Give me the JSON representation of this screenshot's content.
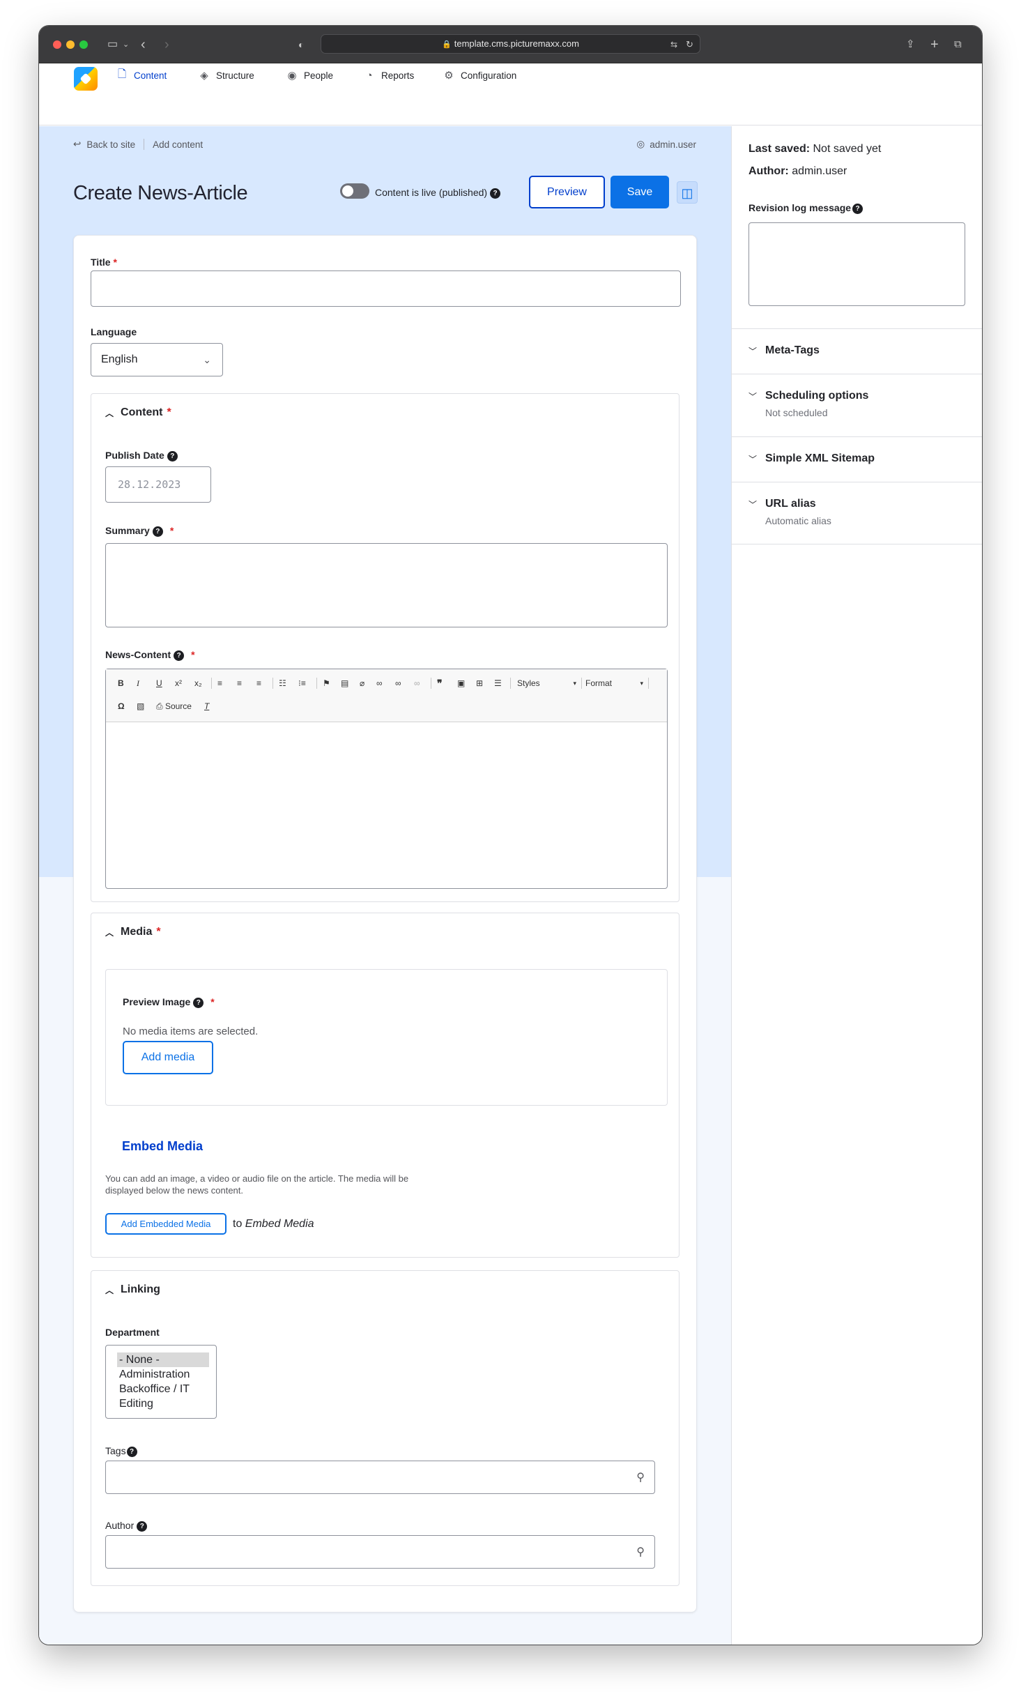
{
  "browser": {
    "url": "template.cms.picturemaxx.com"
  },
  "nav": {
    "items": [
      {
        "label": "Content",
        "icon": "document-icon"
      },
      {
        "label": "Structure",
        "icon": "layers-icon"
      },
      {
        "label": "People",
        "icon": "person-icon"
      },
      {
        "label": "Reports",
        "icon": "chart-icon"
      },
      {
        "label": "Configuration",
        "icon": "gear-icon"
      }
    ]
  },
  "header": {
    "back_link": "Back to site",
    "breadcrumb_current": "Add content",
    "user": "admin.user",
    "title": "Create News-Article",
    "live_toggle_label": "Content is live (published)",
    "preview_label": "Preview",
    "save_label": "Save"
  },
  "form": {
    "title_label": "Title",
    "title_value": "",
    "language_label": "Language",
    "language_value": "English",
    "content": {
      "legend": "Content",
      "publish_date_label": "Publish Date",
      "publish_date_placeholder": "28.12.2023",
      "summary_label": "Summary",
      "news_content_label": "News-Content",
      "toolbar": {
        "styles_label": "Styles",
        "format_label": "Format",
        "source_label": "Source"
      }
    },
    "media": {
      "legend": "Media",
      "preview_image_label": "Preview Image",
      "no_media_text": "No media items are selected.",
      "add_media_label": "Add media",
      "embed_title": "Embed Media",
      "embed_description": "You can add an image, a video or audio file on the article. The media will be displayed below the news content.",
      "add_embedded_label": "Add Embedded Media",
      "embed_to_prefix": "to",
      "embed_to_target": "Embed Media"
    },
    "linking": {
      "legend": "Linking",
      "department_label": "Department",
      "departments": [
        "- None -",
        "Administration",
        "Backoffice / IT",
        "Editing"
      ],
      "tags_label": "Tags",
      "author_label": "Author"
    }
  },
  "sidebar": {
    "last_saved_label": "Last saved:",
    "last_saved_value": "Not saved yet",
    "author_label": "Author:",
    "author_value": "admin.user",
    "revision_label": "Revision log message",
    "sections": [
      {
        "title": "Meta-Tags",
        "subtitle": ""
      },
      {
        "title": "Scheduling options",
        "subtitle": "Not scheduled"
      },
      {
        "title": "Simple XML Sitemap",
        "subtitle": ""
      },
      {
        "title": "URL alias",
        "subtitle": "Automatic alias"
      }
    ]
  },
  "colors": {
    "accent": "#003ecc",
    "primary_button": "#0b71e6",
    "hero_bg": "#d8e8fe",
    "required": "#dc2323"
  }
}
